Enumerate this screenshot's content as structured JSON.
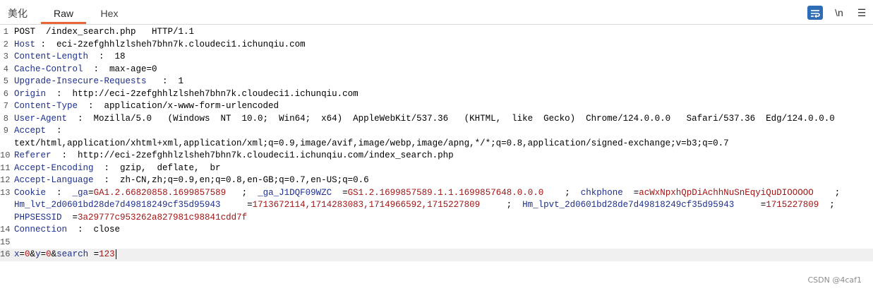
{
  "tabs": [
    {
      "label": "美化"
    },
    {
      "label": "Raw"
    },
    {
      "label": "Hex"
    }
  ],
  "toolbar": {
    "wrap_icon": "wrap-text-icon",
    "newline_label": "\\n",
    "menu_icon": "menu-icon",
    "menu_glyph": "☰"
  },
  "request": {
    "lines": [
      {
        "n": "1",
        "tokens": [
          {
            "t": "POST  /index_search.php   HTTP/1.1",
            "c": "p"
          }
        ]
      },
      {
        "n": "2",
        "tokens": [
          {
            "t": "Host",
            "c": "k"
          },
          {
            "t": " :  eci-2zefghhlzlsheh7bhn7k.cloudeci1.ichunqiu.com",
            "c": "v"
          }
        ]
      },
      {
        "n": "3",
        "tokens": [
          {
            "t": "Content-Length",
            "c": "k"
          },
          {
            "t": "  :  18",
            "c": "v"
          }
        ]
      },
      {
        "n": "4",
        "tokens": [
          {
            "t": "Cache-Control",
            "c": "k"
          },
          {
            "t": "  :  max-age=0",
            "c": "v"
          }
        ]
      },
      {
        "n": "5",
        "tokens": [
          {
            "t": "Upgrade-Insecure-Requests",
            "c": "k"
          },
          {
            "t": "   :  1",
            "c": "v"
          }
        ]
      },
      {
        "n": "6",
        "tokens": [
          {
            "t": "Origin",
            "c": "k"
          },
          {
            "t": "  :  http://eci-2zefghhlzlsheh7bhn7k.cloudeci1.ichunqiu.com",
            "c": "v"
          }
        ]
      },
      {
        "n": "7",
        "tokens": [
          {
            "t": "Content-Type",
            "c": "k"
          },
          {
            "t": "  :  application/x-www-form-urlencoded",
            "c": "v"
          }
        ]
      },
      {
        "n": "8",
        "tokens": [
          {
            "t": "User-Agent",
            "c": "k"
          },
          {
            "t": "  :  Mozilla/5.0   (Windows  NT  10.0;  Win64;  x64)  AppleWebKit/537.36   (KHTML,  like  Gecko)  Chrome/124.0.0.0   Safari/537.36  Edg/124.0.0.0",
            "c": "v"
          }
        ]
      },
      {
        "n": "9",
        "tokens": [
          {
            "t": "Accept",
            "c": "k"
          },
          {
            "t": "  :",
            "c": "v"
          }
        ]
      },
      {
        "n": "",
        "tokens": [
          {
            "t": "text/html,application/xhtml+xml,application/xml;q=0.9,image/avif,image/webp,image/apng,*/*;q=0.8,application/signed-exchange;v=b3;q=0.7",
            "c": "v"
          }
        ]
      },
      {
        "n": "10",
        "tokens": [
          {
            "t": "Referer",
            "c": "k"
          },
          {
            "t": "  :  http://eci-2zefghhlzlsheh7bhn7k.cloudeci1.ichunqiu.com/index_search.php",
            "c": "v"
          }
        ]
      },
      {
        "n": "11",
        "tokens": [
          {
            "t": "Accept-Encoding",
            "c": "k"
          },
          {
            "t": "  :  gzip,  deflate,  br",
            "c": "v"
          }
        ]
      },
      {
        "n": "12",
        "tokens": [
          {
            "t": "Accept-Language",
            "c": "k"
          },
          {
            "t": "  :  zh-CN,zh;q=0.9,en;q=0.8,en-GB;q=0.7,en-US;q=0.6",
            "c": "v"
          }
        ]
      },
      {
        "n": "13",
        "tokens": [
          {
            "t": "Cookie",
            "c": "k"
          },
          {
            "t": "  :  ",
            "c": "v"
          },
          {
            "t": "_ga",
            "c": "k"
          },
          {
            "t": "=",
            "c": "v"
          },
          {
            "t": "GA1.2.66820858.1699857589",
            "c": "r"
          },
          {
            "t": "   ;  ",
            "c": "v"
          },
          {
            "t": "_ga_J1DQF09WZC",
            "c": "k"
          },
          {
            "t": "  =",
            "c": "v"
          },
          {
            "t": "GS1.2.1699857589.1.1.1699857648.0.0.0",
            "c": "r"
          },
          {
            "t": "    ;  ",
            "c": "v"
          },
          {
            "t": "chkphone",
            "c": "k"
          },
          {
            "t": "  =",
            "c": "v"
          },
          {
            "t": "acWxNpxhQpDiAchhNuSnEqyiQuDIOOOOO",
            "c": "r"
          },
          {
            "t": "    ;",
            "c": "v"
          }
        ]
      },
      {
        "n": "",
        "tokens": [
          {
            "t": "Hm_lvt_2d0601bd28de7d49818249cf35d95943",
            "c": "k"
          },
          {
            "t": "     =",
            "c": "v"
          },
          {
            "t": "1713672114,1714283083,1714966592,1715227809",
            "c": "r"
          },
          {
            "t": "     ;  ",
            "c": "v"
          },
          {
            "t": "Hm_lpvt_2d0601bd28de7d49818249cf35d95943",
            "c": "k"
          },
          {
            "t": "     =",
            "c": "v"
          },
          {
            "t": "1715227809",
            "c": "r"
          },
          {
            "t": "  ;",
            "c": "v"
          }
        ]
      },
      {
        "n": "",
        "tokens": [
          {
            "t": "PHPSESSID",
            "c": "k"
          },
          {
            "t": "  =",
            "c": "v"
          },
          {
            "t": "3a29777c953262a827981c98841cdd7f",
            "c": "r"
          }
        ]
      },
      {
        "n": "14",
        "tokens": [
          {
            "t": "Connection",
            "c": "k"
          },
          {
            "t": "  :  close",
            "c": "v"
          }
        ]
      },
      {
        "n": "15",
        "tokens": [
          {
            "t": "",
            "c": "v"
          }
        ]
      },
      {
        "n": "16",
        "current": true,
        "tokens": [
          {
            "t": "x",
            "c": "k"
          },
          {
            "t": "=",
            "c": "v"
          },
          {
            "t": "0",
            "c": "r"
          },
          {
            "t": "&",
            "c": "v"
          },
          {
            "t": "y",
            "c": "k"
          },
          {
            "t": "=",
            "c": "v"
          },
          {
            "t": "0",
            "c": "r"
          },
          {
            "t": "&",
            "c": "v"
          },
          {
            "t": "search",
            "c": "k"
          },
          {
            "t": " =",
            "c": "v"
          },
          {
            "t": "123",
            "c": "r"
          }
        ]
      }
    ]
  },
  "watermark": "CSDN @4caf1",
  "colors": {
    "accent": "#e8663a",
    "key": "#1d2f8f",
    "value": "#a31515",
    "toolbar_button": "#2e6db5"
  }
}
